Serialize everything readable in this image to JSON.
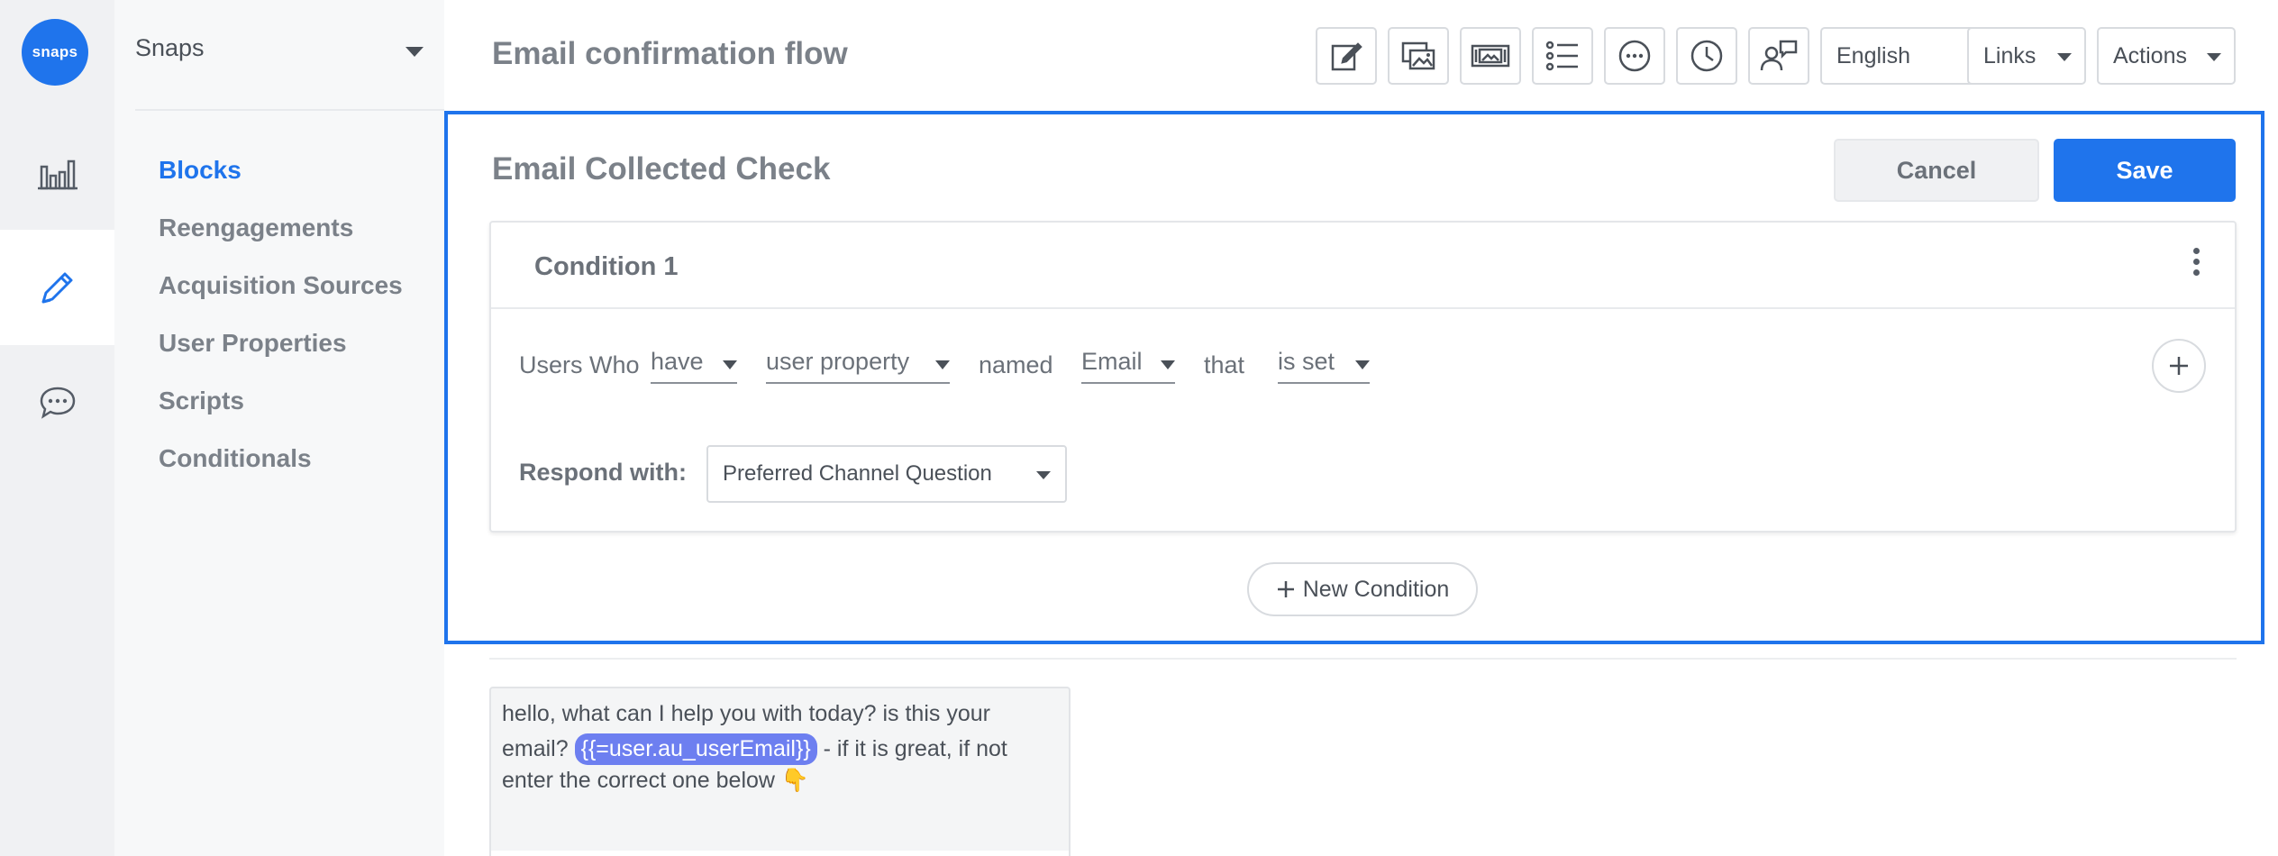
{
  "rail": {
    "logo_text": "snaps",
    "items": [
      {
        "name": "analytics",
        "icon": "bar-chart-icon"
      },
      {
        "name": "edit",
        "icon": "pencil-icon",
        "active": true
      },
      {
        "name": "chat",
        "icon": "chat-bubble-icon"
      }
    ]
  },
  "sidebar": {
    "workspace": "Snaps",
    "items": [
      {
        "label": "Blocks",
        "active": true
      },
      {
        "label": "Reengagements"
      },
      {
        "label": "Acquisition Sources"
      },
      {
        "label": "User Properties"
      },
      {
        "label": "Scripts"
      },
      {
        "label": "Conditionals"
      }
    ]
  },
  "header": {
    "title": "Email confirmation flow",
    "toolbar_icons": [
      "edit-note-icon",
      "gallery-icon",
      "carousel-icon",
      "list-icon",
      "more-dots-icon",
      "clock-icon",
      "handoff-icon"
    ],
    "language": "English",
    "links": "Links",
    "actions": "Actions"
  },
  "block": {
    "title": "Email Collected Check",
    "cancel_label": "Cancel",
    "save_label": "Save",
    "condition": {
      "title": "Condition 1",
      "users_who": "Users Who",
      "have": "have",
      "property_type": "user property",
      "named": "named",
      "property_name": "Email",
      "that": "that",
      "operator": "is set",
      "respond_label": "Respond with:",
      "respond_value": "Preferred Channel Question"
    },
    "new_condition_label": "New Condition"
  },
  "message": {
    "line1": "hello, what can I help you with today? is this your",
    "line2_prefix": "email?",
    "variable": "{{=user.au_userEmail}}",
    "line2_suffix": "- if it is great, if not",
    "line3": "enter the correct one below",
    "emoji": "👇"
  },
  "colors": {
    "accent": "#1f74ec",
    "variable_chip": "#6d7ff0"
  }
}
